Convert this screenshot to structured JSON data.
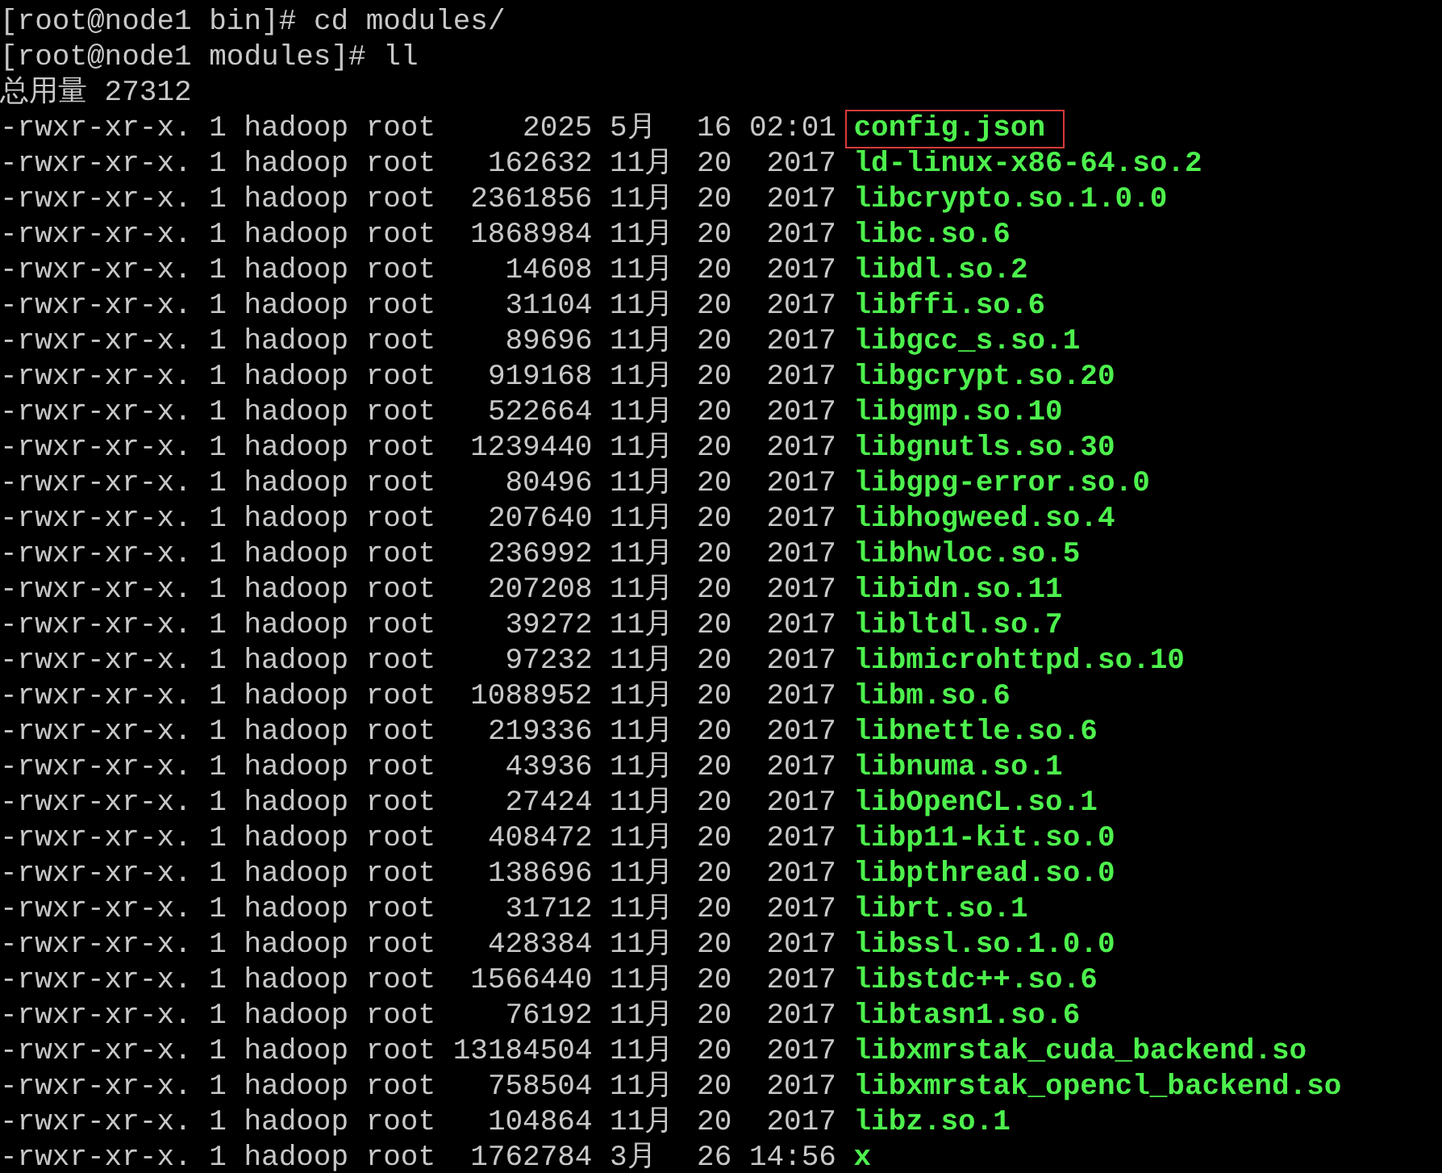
{
  "terminal": {
    "lines": [
      {
        "prompt": "[root@node1 bin]#",
        "command": "cd modules/"
      },
      {
        "prompt": "[root@node1 modules]#",
        "command": "ll"
      }
    ],
    "total": {
      "label": "总用量",
      "value": "27312"
    },
    "files": [
      {
        "perms": "-rwxr-xr-x.",
        "links": "1",
        "owner": "hadoop",
        "group": "root",
        "size": "2025",
        "month": "5月",
        "day": "16",
        "time": "02:01",
        "name": "config.json",
        "boxed": true
      },
      {
        "perms": "-rwxr-xr-x.",
        "links": "1",
        "owner": "hadoop",
        "group": "root",
        "size": "162632",
        "month": "11月",
        "day": "20",
        "time": "2017",
        "name": "ld-linux-x86-64.so.2",
        "boxed": false
      },
      {
        "perms": "-rwxr-xr-x.",
        "links": "1",
        "owner": "hadoop",
        "group": "root",
        "size": "2361856",
        "month": "11月",
        "day": "20",
        "time": "2017",
        "name": "libcrypto.so.1.0.0",
        "boxed": false
      },
      {
        "perms": "-rwxr-xr-x.",
        "links": "1",
        "owner": "hadoop",
        "group": "root",
        "size": "1868984",
        "month": "11月",
        "day": "20",
        "time": "2017",
        "name": "libc.so.6",
        "boxed": false
      },
      {
        "perms": "-rwxr-xr-x.",
        "links": "1",
        "owner": "hadoop",
        "group": "root",
        "size": "14608",
        "month": "11月",
        "day": "20",
        "time": "2017",
        "name": "libdl.so.2",
        "boxed": false
      },
      {
        "perms": "-rwxr-xr-x.",
        "links": "1",
        "owner": "hadoop",
        "group": "root",
        "size": "31104",
        "month": "11月",
        "day": "20",
        "time": "2017",
        "name": "libffi.so.6",
        "boxed": false
      },
      {
        "perms": "-rwxr-xr-x.",
        "links": "1",
        "owner": "hadoop",
        "group": "root",
        "size": "89696",
        "month": "11月",
        "day": "20",
        "time": "2017",
        "name": "libgcc_s.so.1",
        "boxed": false
      },
      {
        "perms": "-rwxr-xr-x.",
        "links": "1",
        "owner": "hadoop",
        "group": "root",
        "size": "919168",
        "month": "11月",
        "day": "20",
        "time": "2017",
        "name": "libgcrypt.so.20",
        "boxed": false
      },
      {
        "perms": "-rwxr-xr-x.",
        "links": "1",
        "owner": "hadoop",
        "group": "root",
        "size": "522664",
        "month": "11月",
        "day": "20",
        "time": "2017",
        "name": "libgmp.so.10",
        "boxed": false
      },
      {
        "perms": "-rwxr-xr-x.",
        "links": "1",
        "owner": "hadoop",
        "group": "root",
        "size": "1239440",
        "month": "11月",
        "day": "20",
        "time": "2017",
        "name": "libgnutls.so.30",
        "boxed": false
      },
      {
        "perms": "-rwxr-xr-x.",
        "links": "1",
        "owner": "hadoop",
        "group": "root",
        "size": "80496",
        "month": "11月",
        "day": "20",
        "time": "2017",
        "name": "libgpg-error.so.0",
        "boxed": false
      },
      {
        "perms": "-rwxr-xr-x.",
        "links": "1",
        "owner": "hadoop",
        "group": "root",
        "size": "207640",
        "month": "11月",
        "day": "20",
        "time": "2017",
        "name": "libhogweed.so.4",
        "boxed": false
      },
      {
        "perms": "-rwxr-xr-x.",
        "links": "1",
        "owner": "hadoop",
        "group": "root",
        "size": "236992",
        "month": "11月",
        "day": "20",
        "time": "2017",
        "name": "libhwloc.so.5",
        "boxed": false
      },
      {
        "perms": "-rwxr-xr-x.",
        "links": "1",
        "owner": "hadoop",
        "group": "root",
        "size": "207208",
        "month": "11月",
        "day": "20",
        "time": "2017",
        "name": "libidn.so.11",
        "boxed": false
      },
      {
        "perms": "-rwxr-xr-x.",
        "links": "1",
        "owner": "hadoop",
        "group": "root",
        "size": "39272",
        "month": "11月",
        "day": "20",
        "time": "2017",
        "name": "libltdl.so.7",
        "boxed": false
      },
      {
        "perms": "-rwxr-xr-x.",
        "links": "1",
        "owner": "hadoop",
        "group": "root",
        "size": "97232",
        "month": "11月",
        "day": "20",
        "time": "2017",
        "name": "libmicrohttpd.so.10",
        "boxed": false
      },
      {
        "perms": "-rwxr-xr-x.",
        "links": "1",
        "owner": "hadoop",
        "group": "root",
        "size": "1088952",
        "month": "11月",
        "day": "20",
        "time": "2017",
        "name": "libm.so.6",
        "boxed": false
      },
      {
        "perms": "-rwxr-xr-x.",
        "links": "1",
        "owner": "hadoop",
        "group": "root",
        "size": "219336",
        "month": "11月",
        "day": "20",
        "time": "2017",
        "name": "libnettle.so.6",
        "boxed": false
      },
      {
        "perms": "-rwxr-xr-x.",
        "links": "1",
        "owner": "hadoop",
        "group": "root",
        "size": "43936",
        "month": "11月",
        "day": "20",
        "time": "2017",
        "name": "libnuma.so.1",
        "boxed": false
      },
      {
        "perms": "-rwxr-xr-x.",
        "links": "1",
        "owner": "hadoop",
        "group": "root",
        "size": "27424",
        "month": "11月",
        "day": "20",
        "time": "2017",
        "name": "libOpenCL.so.1",
        "boxed": false
      },
      {
        "perms": "-rwxr-xr-x.",
        "links": "1",
        "owner": "hadoop",
        "group": "root",
        "size": "408472",
        "month": "11月",
        "day": "20",
        "time": "2017",
        "name": "libp11-kit.so.0",
        "boxed": false
      },
      {
        "perms": "-rwxr-xr-x.",
        "links": "1",
        "owner": "hadoop",
        "group": "root",
        "size": "138696",
        "month": "11月",
        "day": "20",
        "time": "2017",
        "name": "libpthread.so.0",
        "boxed": false
      },
      {
        "perms": "-rwxr-xr-x.",
        "links": "1",
        "owner": "hadoop",
        "group": "root",
        "size": "31712",
        "month": "11月",
        "day": "20",
        "time": "2017",
        "name": "librt.so.1",
        "boxed": false
      },
      {
        "perms": "-rwxr-xr-x.",
        "links": "1",
        "owner": "hadoop",
        "group": "root",
        "size": "428384",
        "month": "11月",
        "day": "20",
        "time": "2017",
        "name": "libssl.so.1.0.0",
        "boxed": false
      },
      {
        "perms": "-rwxr-xr-x.",
        "links": "1",
        "owner": "hadoop",
        "group": "root",
        "size": "1566440",
        "month": "11月",
        "day": "20",
        "time": "2017",
        "name": "libstdc++.so.6",
        "boxed": false
      },
      {
        "perms": "-rwxr-xr-x.",
        "links": "1",
        "owner": "hadoop",
        "group": "root",
        "size": "76192",
        "month": "11月",
        "day": "20",
        "time": "2017",
        "name": "libtasn1.so.6",
        "boxed": false
      },
      {
        "perms": "-rwxr-xr-x.",
        "links": "1",
        "owner": "hadoop",
        "group": "root",
        "size": "13184504",
        "month": "11月",
        "day": "20",
        "time": "2017",
        "name": "libxmrstak_cuda_backend.so",
        "boxed": false
      },
      {
        "perms": "-rwxr-xr-x.",
        "links": "1",
        "owner": "hadoop",
        "group": "root",
        "size": "758504",
        "month": "11月",
        "day": "20",
        "time": "2017",
        "name": "libxmrstak_opencl_backend.so",
        "boxed": false
      },
      {
        "perms": "-rwxr-xr-x.",
        "links": "1",
        "owner": "hadoop",
        "group": "root",
        "size": "104864",
        "month": "11月",
        "day": "20",
        "time": "2017",
        "name": "libz.so.1",
        "boxed": false
      },
      {
        "perms": "-rwxr-xr-x.",
        "links": "1",
        "owner": "hadoop",
        "group": "root",
        "size": "1762784",
        "month": "3月",
        "day": "26",
        "time": "14:56",
        "name": "x",
        "boxed": false
      }
    ]
  }
}
